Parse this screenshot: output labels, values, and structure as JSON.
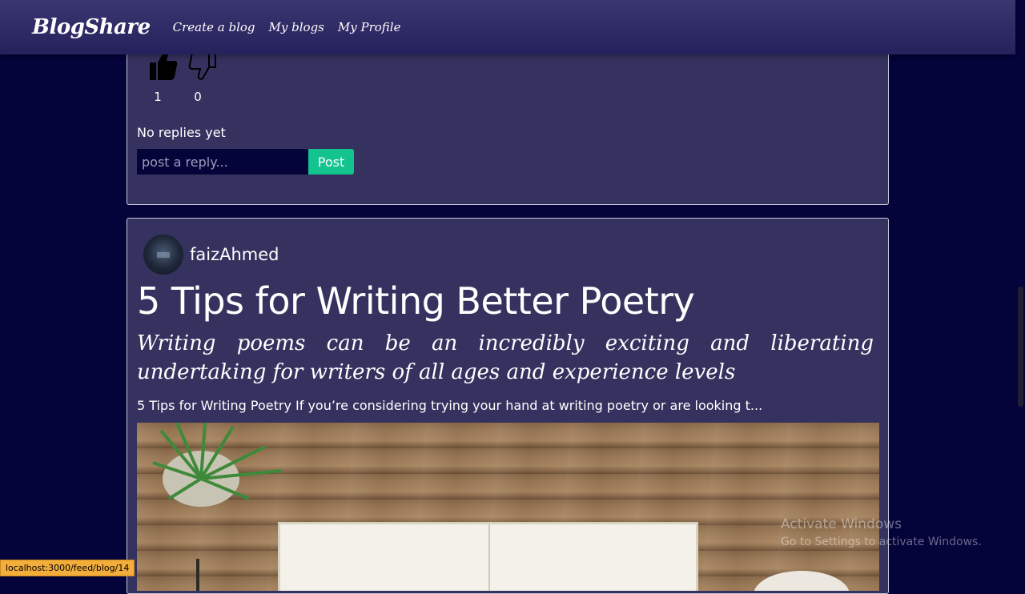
{
  "navbar": {
    "brand": "BlogShare",
    "links": [
      "Create a blog",
      "My blogs",
      "My Profile"
    ]
  },
  "previous_post": {
    "likes": "1",
    "dislikes": "0",
    "replies_status": "No replies yet",
    "reply_placeholder": "post a reply...",
    "post_button": "Post"
  },
  "post": {
    "author": "faizAhmed",
    "title": "5 Tips for Writing Better Poetry",
    "subtitle": "Writing poems can be an incredibly exciting and liberating undertaking for writers of all ages and experience levels",
    "excerpt": "5 Tips for Writing Poetry If you’re considering trying your hand at writing poetry or are looking t..."
  },
  "status_bar": {
    "url": "localhost:3000/feed/blog/14"
  },
  "watermark": {
    "title": "Activate Windows",
    "subtitle": "Go to Settings to activate Windows."
  },
  "icons": {
    "like": "thumbs-up-icon",
    "dislike": "thumbs-down-icon"
  },
  "colors": {
    "page_background": "#04033a",
    "card_background": "#35325f",
    "post_button": "#13c48f"
  }
}
